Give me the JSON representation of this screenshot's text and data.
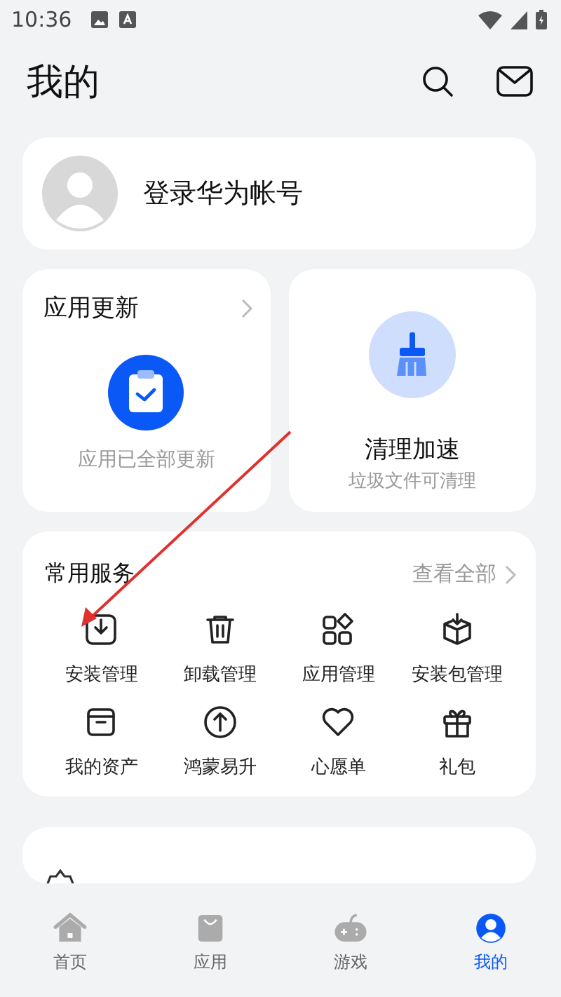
{
  "status_bar": {
    "time": "10:36"
  },
  "header": {
    "title": "我的"
  },
  "account": {
    "label": "登录华为帐号"
  },
  "update_card": {
    "title": "应用更新",
    "subtitle": "应用已全部更新"
  },
  "clean_card": {
    "title": "清理加速",
    "subtitle": "垃圾文件可清理"
  },
  "services": {
    "title": "常用服务",
    "view_all": "查看全部",
    "items": [
      {
        "label": "安装管理"
      },
      {
        "label": "卸载管理"
      },
      {
        "label": "应用管理"
      },
      {
        "label": "安装包管理"
      },
      {
        "label": "我的资产"
      },
      {
        "label": "鸿蒙易升"
      },
      {
        "label": "心愿单"
      },
      {
        "label": "礼包"
      }
    ]
  },
  "bottom_nav": [
    {
      "label": "首页",
      "selected": false
    },
    {
      "label": "应用",
      "selected": false
    },
    {
      "label": "游戏",
      "selected": false
    },
    {
      "label": "我的",
      "selected": true
    }
  ]
}
